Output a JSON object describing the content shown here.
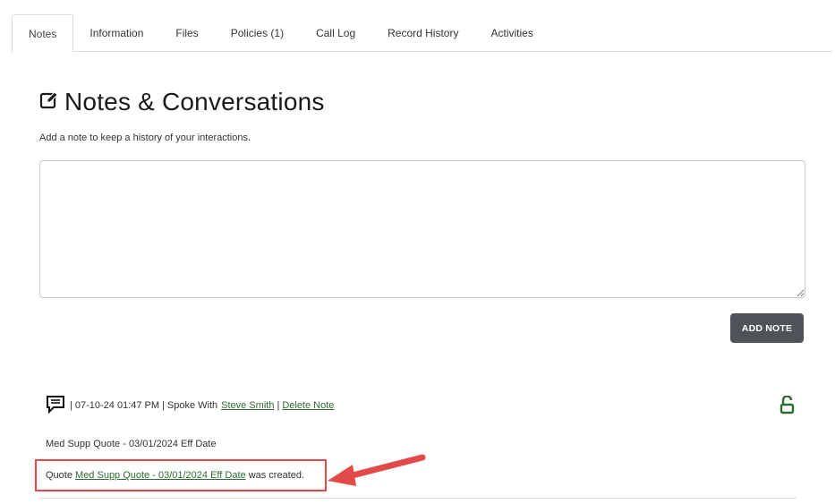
{
  "tabs": [
    {
      "label": "Notes"
    },
    {
      "label": "Information"
    },
    {
      "label": "Files"
    },
    {
      "label": "Policies (1)"
    },
    {
      "label": "Call Log"
    },
    {
      "label": "Record History"
    },
    {
      "label": "Activities"
    }
  ],
  "header": {
    "title": "Notes & Conversations",
    "subtitle": "Add a note to keep a history of your interactions.",
    "icon": "edit-icon"
  },
  "note_input": {
    "value": "",
    "placeholder": ""
  },
  "add_button": {
    "label": "ADD NOTE"
  },
  "note": {
    "icon": "comment-icon",
    "lock_icon": "unlocked-icon",
    "timestamp": "07-10-24 01:47 PM",
    "spoke_with_label": "Spoke With",
    "contact": "Steve Smith",
    "delete_label": "Delete Note",
    "subject": "Med Supp Quote - 03/01/2024 Eff Date",
    "quote_prefix": "Quote",
    "quote_link": "Med Supp Quote - 03/01/2024 Eff Date",
    "quote_suffix": "was created."
  },
  "colors": {
    "link": "#2e6b33",
    "button": "#4d5358",
    "highlight": "#e24a4a"
  }
}
